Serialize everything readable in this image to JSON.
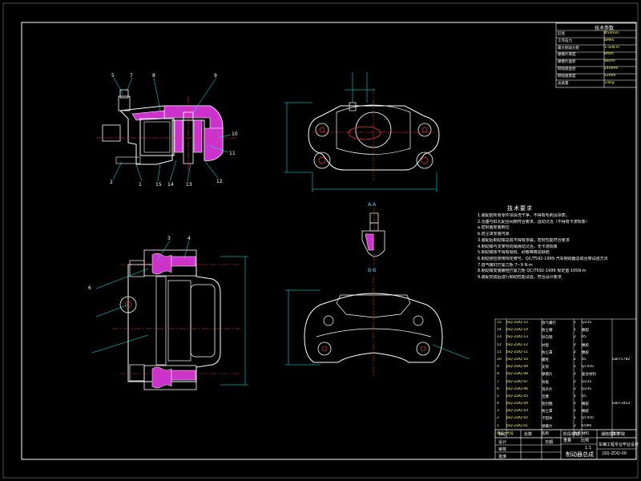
{
  "colors": {
    "background": "#000000",
    "frame": "#ffffff",
    "part_outline": "#ffffff",
    "section_fill": "#cc33cc",
    "center_line": "#ff3333",
    "dimension": "#00ffff",
    "text": "#ffffff",
    "accent_text": "#ffff66"
  },
  "spec_table": {
    "title": "技术参数",
    "rows": [
      {
        "key": "缸径",
        "value": "Φ54mm"
      },
      {
        "key": "工作压力",
        "value": "8MPa"
      },
      {
        "key": "最大制动力矩",
        "value": "1.5kN·m"
      },
      {
        "key": "摩擦片厚度",
        "value": "8mm"
      },
      {
        "key": "摩擦片面积",
        "value": "48cm²"
      },
      {
        "key": "制动盘直径",
        "value": "240mm"
      },
      {
        "key": "制动盘厚度",
        "value": "12mm"
      },
      {
        "key": "总质量",
        "value": "3.6kg"
      }
    ]
  },
  "notes": {
    "title": "技术要求",
    "lines": [
      "1.装配前所有零件须清洗干净，不得有毛刺及杂质。",
      "2.活塞与缸孔配合间隙符合要求，运动灵活（不得有卡滞现象）",
      "  a.密封圈安装到位",
      "  b.防尘罩安装可靠",
      "3.装配后制动钳总成不得有渗漏，密封性能符合要求",
      "4.制动钳与支架导向销滑动灵活，无卡滞现象",
      "5.制动钳体不得有裂纹、砂眼等铸造缺陷",
      "6.制动液应使用规定牌号，QC/T592-1999 汽车制动器总成台架试验方法",
      "7.放气螺钉拧紧力矩 7~9 N·m",
      "8.制动钳安装螺栓拧紧力矩 QC/T592-1999 规定值 105N·m",
      "9.装配完成后进行制动性能试验，符合设计要求"
    ]
  },
  "view_labels": {
    "section_a": "A-A",
    "section_b": "B-B"
  },
  "leader_numbers": [
    "5",
    "7",
    "8",
    "9",
    "10",
    "11",
    "12",
    "13",
    "14",
    "15",
    "1",
    "2",
    "3",
    "4",
    "6"
  ],
  "bom": {
    "rows": [
      {
        "n": "15",
        "code": "JSQ-ZDQ-15",
        "name": "放气螺钉",
        "qty": "1",
        "mat": "Q235",
        "rem": ""
      },
      {
        "n": "14",
        "code": "JSQ-ZDQ-14",
        "name": "防尘帽",
        "qty": "1",
        "mat": "橡胶",
        "rem": ""
      },
      {
        "n": "13",
        "code": "JSQ-ZDQ-13",
        "name": "导向销",
        "qty": "2",
        "mat": "45",
        "rem": ""
      },
      {
        "n": "12",
        "code": "JSQ-ZDQ-12",
        "name": "衬套",
        "qty": "2",
        "mat": "橡胶",
        "rem": ""
      },
      {
        "n": "11",
        "code": "JSQ-ZDQ-11",
        "name": "防尘罩",
        "qty": "2",
        "mat": "橡胶",
        "rem": ""
      },
      {
        "n": "10",
        "code": "JSQ-ZDQ-10",
        "name": "螺栓",
        "qty": "2",
        "mat": "45",
        "rem": "GB/T5782"
      },
      {
        "n": "9",
        "code": "JSQ-ZDQ-09",
        "name": "支架",
        "qty": "1",
        "mat": "QT450",
        "rem": ""
      },
      {
        "n": "8",
        "code": "JSQ-ZDQ-08",
        "name": "摩擦片",
        "qty": "2",
        "mat": "复合材料",
        "rem": ""
      },
      {
        "n": "7",
        "code": "JSQ-ZDQ-07",
        "name": "背板",
        "qty": "2",
        "mat": "Q235",
        "rem": ""
      },
      {
        "n": "6",
        "code": "JSQ-ZDQ-06",
        "name": "消声片",
        "qty": "2",
        "mat": "Q235",
        "rem": ""
      },
      {
        "n": "5",
        "code": "JSQ-ZDQ-05",
        "name": "活塞",
        "qty": "1",
        "mat": "45",
        "rem": ""
      },
      {
        "n": "4",
        "code": "JSQ-ZDQ-04",
        "name": "密封圈",
        "qty": "1",
        "mat": "橡胶",
        "rem": "GB/T3452"
      },
      {
        "n": "3",
        "code": "JSQ-ZDQ-03",
        "name": "防尘罩",
        "qty": "1",
        "mat": "橡胶",
        "rem": ""
      },
      {
        "n": "2",
        "code": "JSQ-ZDQ-02",
        "name": "卡钳体",
        "qty": "1",
        "mat": "QT450",
        "rem": ""
      },
      {
        "n": "1",
        "code": "JSQ-ZDQ-01",
        "name": "弹簧片",
        "qty": "2",
        "mat": "65Mn",
        "rem": ""
      }
    ],
    "header": {
      "n": "序号",
      "code": "代号",
      "name": "名称",
      "qty": "数量",
      "mat": "材料",
      "rem": "备注"
    }
  },
  "title_block": {
    "school": "湖南理工学院",
    "class": "车辆工程专业毕业设计",
    "drawing_title": "制动钳总成",
    "scale": "1:1",
    "sheet": "共1张 第1张",
    "drawing_no": "JSQ-ZDQ-00",
    "designer_label": "设计",
    "checker_label": "审核",
    "approver_label": "批准",
    "date_label": "日期",
    "mark_label": "标记",
    "count_label": "处数",
    "stage_label": "阶段标记",
    "weight_label": "重量",
    "scale_label": "比例",
    "drawing_title_main": "制动器总成"
  }
}
